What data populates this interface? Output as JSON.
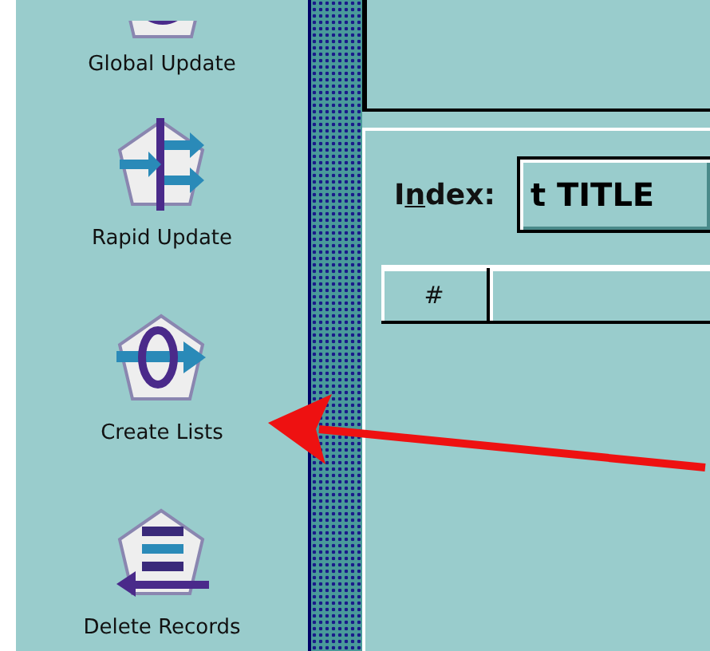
{
  "sidebar": {
    "items": [
      {
        "label": "Global Update"
      },
      {
        "label": "Rapid Update"
      },
      {
        "label": "Create Lists"
      },
      {
        "label": "Delete Records"
      }
    ]
  },
  "index": {
    "label_before": "I",
    "mnemonic": "n",
    "label_after": "dex:",
    "value": "t TITLE"
  },
  "table": {
    "columns": [
      "#"
    ]
  },
  "annotation": {
    "kind": "arrow"
  }
}
